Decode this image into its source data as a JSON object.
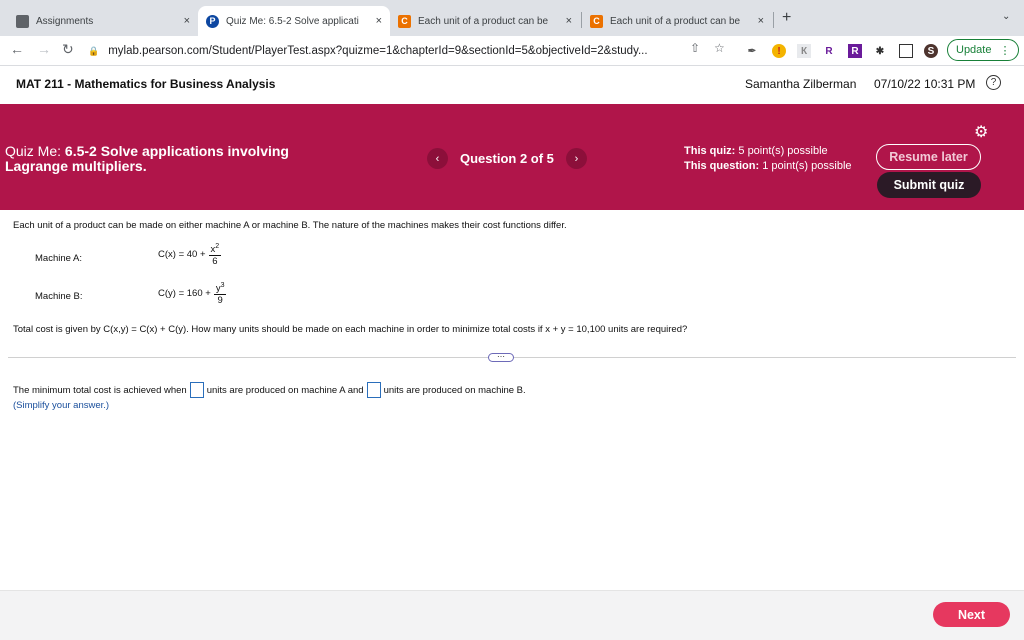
{
  "browser": {
    "tabs": [
      {
        "title": "Assignments",
        "close": "×"
      },
      {
        "title": "Quiz Me: 6.5-2 Solve applicati",
        "close": "×",
        "favicon": "P"
      },
      {
        "title": "Each unit of a product can be",
        "close": "×",
        "favicon": "C"
      },
      {
        "title": "Each unit of a product can be",
        "close": "×",
        "favicon": "C"
      }
    ],
    "new_tab": "+",
    "url": "mylab.pearson.com/Student/PlayerTest.aspx?quizme=1&chapterId=9&sectionId=5&objectiveId=2&study...",
    "update_label": "Update",
    "profile_initial": "S",
    "colors": {
      "accent": "#188038",
      "chegg": "#eb7100",
      "pearson": "#0d47a1"
    }
  },
  "header": {
    "course": "MAT 211 - Mathematics for Business Analysis",
    "user": "Samantha Zilberman",
    "datetime": "07/10/22 10:31 PM",
    "help": "?"
  },
  "banner": {
    "prefix": "Quiz Me:",
    "title": "Quiz Me: 6.5-2 Solve applications involving Lagrange multipliers.",
    "question_label": "Question 2 of 5",
    "quiz_label": "This quiz:",
    "quiz_points": "5 point(s) possible",
    "question_points_label": "This question:",
    "question_points": "1 point(s) possible",
    "resume": "Resume later",
    "submit": "Submit quiz",
    "color": "#b0154a"
  },
  "question": {
    "intro": "Each unit of a product can be made on either machine A or machine B. The nature of the machines makes their cost functions differ.",
    "machine_a_label": "Machine A:",
    "machine_a_lhs": "C(x) = 40 +",
    "machine_a_num": "x",
    "machine_a_exp": "2",
    "machine_a_den": "6",
    "machine_b_label": "Machine B:",
    "machine_b_lhs": "C(y) = 160 +",
    "machine_b_num": "y",
    "machine_b_exp": "3",
    "machine_b_den": "9",
    "total": "Total cost is given by C(x,y) = C(x) + C(y). How many units should be made on each machine in order to minimize total costs if x + y = 10,100 units are required?",
    "answer_pre": "The minimum total cost is achieved when",
    "answer_mid": "units are produced on machine A and",
    "answer_post": "units are produced on machine B.",
    "simplify": "(Simplify your answer.)"
  },
  "footer": {
    "next": "Next"
  }
}
